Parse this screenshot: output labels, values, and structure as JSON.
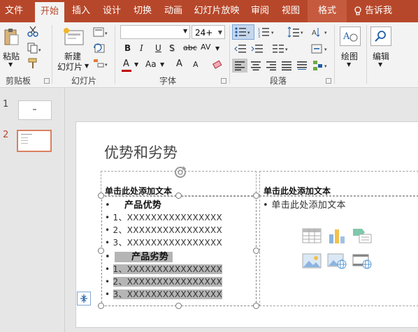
{
  "tabs": [
    {
      "label": "文件",
      "active": false
    },
    {
      "label": "开始",
      "active": true
    },
    {
      "label": "插入",
      "active": false
    },
    {
      "label": "设计",
      "active": false
    },
    {
      "label": "切换",
      "active": false
    },
    {
      "label": "动画",
      "active": false
    },
    {
      "label": "幻灯片放映",
      "active": false
    },
    {
      "label": "审阅",
      "active": false
    },
    {
      "label": "视图",
      "active": false
    },
    {
      "label": "格式",
      "active": false
    }
  ],
  "tell_me": "告诉我",
  "ribbon": {
    "clipboard": {
      "paste": "粘贴",
      "group": "剪贴板"
    },
    "slides": {
      "new_slide_line1": "新建",
      "new_slide_line2": "幻灯片",
      "group": "幻灯片"
    },
    "font": {
      "font_name": "",
      "font_size": "24+",
      "group": "字体",
      "bold": "B",
      "italic": "I",
      "underline": "U",
      "shadow": "S",
      "strike": "abc",
      "spacing": "AV",
      "color": "A",
      "case": "Aa",
      "grow": "A",
      "shrink": "A"
    },
    "paragraph": {
      "group": "段落"
    },
    "drawing": {
      "label": "绘图"
    },
    "editing": {
      "label": "编辑"
    }
  },
  "thumbnails": [
    {
      "number": "1",
      "selected": false
    },
    {
      "number": "2",
      "selected": true
    }
  ],
  "slide": {
    "title": "优势和劣势",
    "left_header": "单击此处添加文本",
    "right_header": "单击此处添加文本",
    "right_body": "单击此处添加文本",
    "left_body": [
      {
        "bullet": "•",
        "text": "产品优势",
        "bold": true,
        "highlight": false
      },
      {
        "bullet": "•",
        "text": "1、XXXXXXXXXXXXXXXX",
        "bold": false,
        "highlight": false
      },
      {
        "bullet": "•",
        "text": "2、XXXXXXXXXXXXXXXX",
        "bold": false,
        "highlight": false
      },
      {
        "bullet": "•",
        "text": "3、XXXXXXXXXXXXXXXX",
        "bold": false,
        "highlight": false
      },
      {
        "bullet": "•",
        "text": "产品劣势",
        "bold": true,
        "highlight": true
      },
      {
        "bullet": "•",
        "text": "1、XXXXXXXXXXXXXXXX",
        "bold": false,
        "highlight": true
      },
      {
        "bullet": "•",
        "text": "2、XXXXXXXXXXXXXXXX",
        "bold": false,
        "highlight": true
      },
      {
        "bullet": "•",
        "text": "3、XXXXXXXXXXXXXXXX",
        "bold": false,
        "highlight": true
      }
    ]
  },
  "colors": {
    "accent": "#b7472a",
    "ribbon": "#f3f3f3",
    "selection": "#b5b5b5"
  }
}
